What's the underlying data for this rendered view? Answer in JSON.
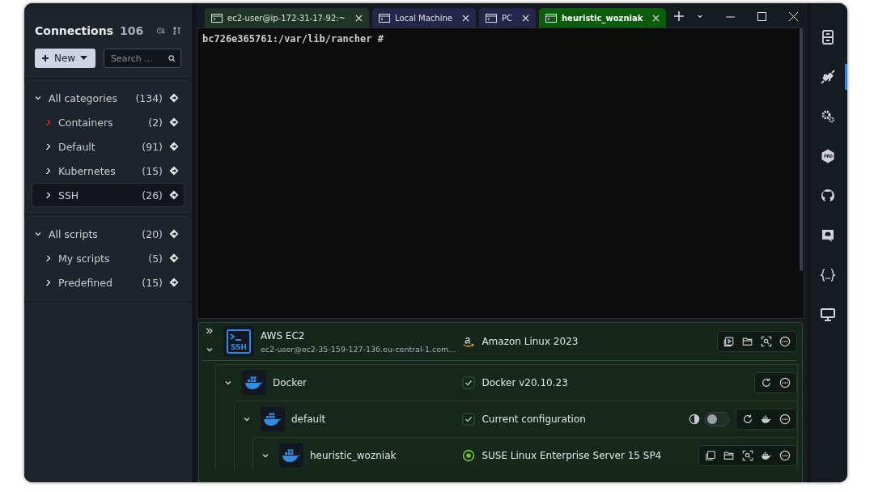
{
  "sidebar": {
    "title": "Connections",
    "count": "106",
    "new_button": "New",
    "search": {
      "placeholder": "Search ..."
    },
    "sections": [
      {
        "label": "All categories",
        "count": "(134)",
        "expanded": true,
        "children": [
          {
            "label": "Containers",
            "count": "(2)",
            "selected": false,
            "color": "#e0202a"
          },
          {
            "label": "Default",
            "count": "(91)",
            "selected": false,
            "color": "#c9ccd1"
          },
          {
            "label": "Kubernetes",
            "count": "(15)",
            "selected": false,
            "color": "#c9ccd1"
          },
          {
            "label": "SSH",
            "count": "(26)",
            "selected": true,
            "color": "#c9ccd1"
          }
        ]
      },
      {
        "label": "All scripts",
        "count": "(20)",
        "expanded": true,
        "children": [
          {
            "label": "My scripts",
            "count": "(5)",
            "selected": false,
            "color": "#c9ccd1"
          },
          {
            "label": "Predefined",
            "count": "(15)",
            "selected": false,
            "color": "#c9ccd1"
          }
        ]
      }
    ]
  },
  "tabs": [
    {
      "label": "ec2-user@ip-172-31-17-92:~",
      "selected": false,
      "color": "#1f3526"
    },
    {
      "label": "Local Machine",
      "selected": false,
      "color": "#25264a"
    },
    {
      "label": "PC",
      "selected": false,
      "color": "#25264a"
    },
    {
      "label": "heuristic_wozniak",
      "selected": true,
      "color": "#0b5d0b"
    }
  ],
  "terminal": {
    "prompt": "bc726e365761:/var/lib/rancher #"
  },
  "tree": {
    "name": "AWS EC2",
    "subtitle": "ec2-user@ec2-35-159-127-136.eu-central-1.com...",
    "kind": "ssh",
    "badge": "SSH",
    "expanded": true,
    "status": {
      "kind": "amazon",
      "text": "Amazon Linux 2023"
    },
    "actions": [
      {
        "kind": "play"
      },
      {
        "kind": "folder"
      },
      {
        "kind": "scan"
      },
      {
        "kind": "more"
      }
    ],
    "children": [
      {
        "name": "Docker",
        "kind": "docker",
        "expanded": true,
        "status": {
          "kind": "check",
          "text": "Docker v20.10.23",
          "checked": true
        },
        "actions": [
          {
            "kind": "refresh"
          },
          {
            "kind": "more"
          }
        ],
        "children": [
          {
            "name": "default",
            "kind": "docker",
            "expanded": true,
            "status": {
              "kind": "check",
              "text": "Current  configuration",
              "checked": true
            },
            "toggle": {
              "on": false
            },
            "actions": [
              {
                "kind": "refresh"
              },
              {
                "kind": "docker"
              },
              {
                "kind": "more"
              }
            ],
            "children": [
              {
                "name": "heuristic_wozniak",
                "kind": "docker",
                "expanded": true,
                "status": {
                  "kind": "suse",
                  "text": "SUSE Linux Enterprise Server 15 SP4"
                },
                "actions": [
                  {
                    "kind": "copy"
                  },
                  {
                    "kind": "folder"
                  },
                  {
                    "kind": "scan"
                  },
                  {
                    "kind": "docker"
                  },
                  {
                    "kind": "more"
                  }
                ]
              }
            ]
          }
        ]
      }
    ]
  },
  "rail": [
    {
      "kind": "cabinet",
      "selected": false
    },
    {
      "kind": "plug",
      "selected": true
    },
    {
      "kind": "gears",
      "selected": false
    },
    {
      "kind": "pro",
      "selected": false
    },
    {
      "kind": "github",
      "selected": false
    },
    {
      "kind": "chat",
      "selected": false
    },
    {
      "kind": "braces",
      "selected": false
    },
    {
      "kind": "monitor",
      "selected": false
    }
  ]
}
